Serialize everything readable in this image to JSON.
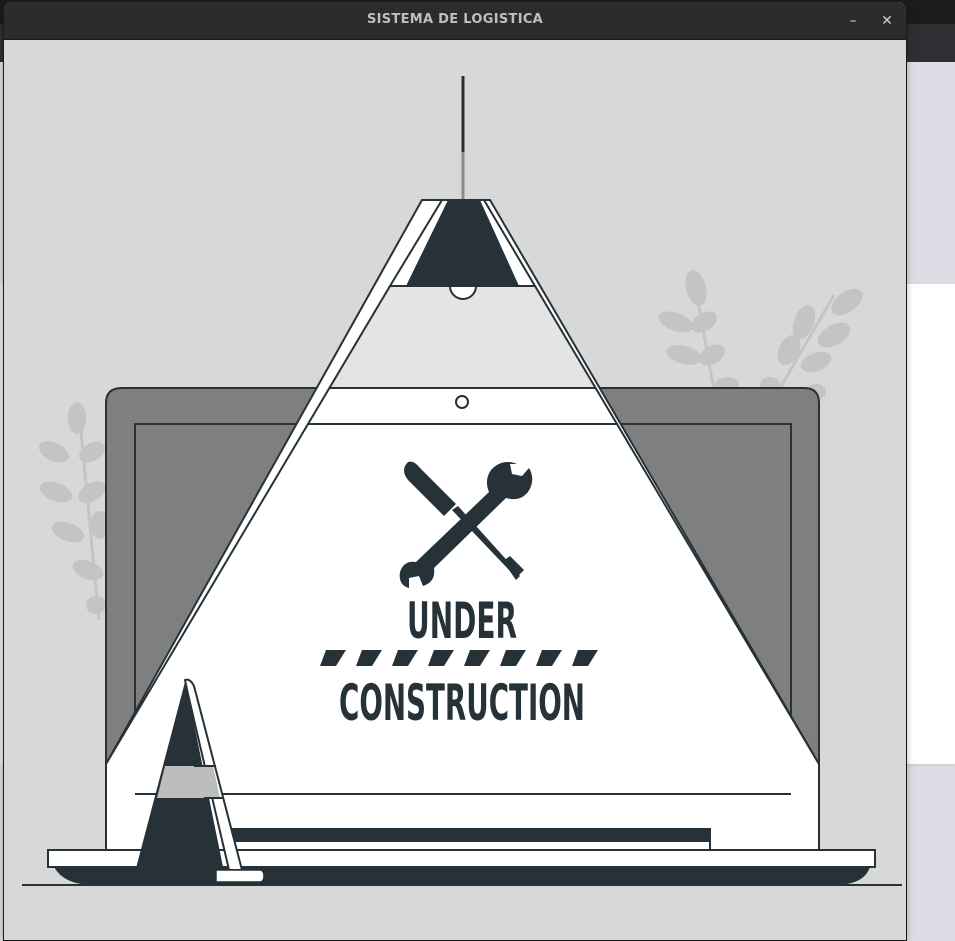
{
  "window": {
    "title": "SISTEMA DE LOGISTICA",
    "minimize_glyph": "–",
    "close_glyph": "✕"
  },
  "illustration": {
    "line1": "UNDER",
    "line2": "CONSTRUCTION",
    "icons": [
      "lamp-icon",
      "screwdriver-icon",
      "wrench-icon",
      "traffic-cone-icon",
      "laptop-icon",
      "plant-icon"
    ]
  },
  "colors": {
    "dark": "#263238",
    "background": "#d8d8d8",
    "titlebar": "#2c2c2c"
  }
}
